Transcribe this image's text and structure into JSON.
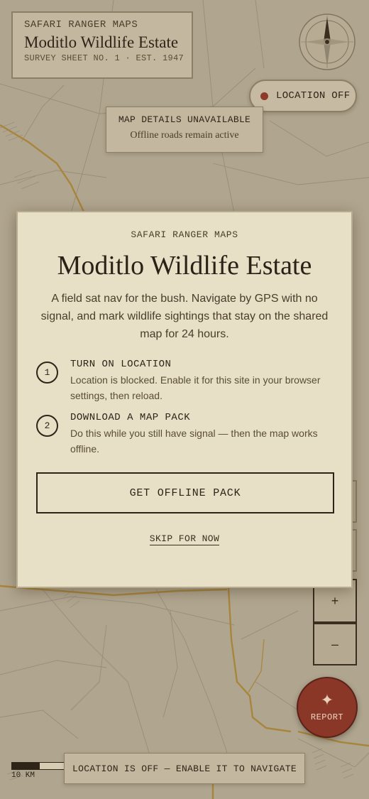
{
  "map": {
    "background": "#b0a58e",
    "road_color": "#a8853d",
    "line_color": "#8f8672"
  },
  "title_card": {
    "kicker": "SAFARI RANGER MAPS",
    "name": "Moditlo Wildlife Estate",
    "sheet": "SURVEY SHEET NO. 1 · EST. 1947"
  },
  "compass": {
    "icon": "compass-rose-icon"
  },
  "location_pill": {
    "label": "LOCATION OFF",
    "status_color": "#8d3a2a"
  },
  "details_card": {
    "heading": "MAP DETAILS UNAVAILABLE",
    "subtext": "Offline roads remain active"
  },
  "zoom": {
    "in_label": "+",
    "out_label": "–"
  },
  "report": {
    "label": "REPORT",
    "icon": "sparkle-icon",
    "color": "#8b3728"
  },
  "scale": {
    "label": "10 KM"
  },
  "status_bar": {
    "text": "LOCATION IS OFF — ENABLE IT TO NAVIGATE"
  },
  "modal": {
    "kicker": "SAFARI RANGER MAPS",
    "title": "Moditlo Wildlife Estate",
    "description": "A field sat nav for the bush. Navigate by GPS with no signal, and mark wildlife sightings that stay on the shared map for 24 hours.",
    "steps": [
      {
        "number": "1",
        "title": "TURN ON LOCATION",
        "description": "Location is blocked. Enable it for this site in your browser settings, then reload."
      },
      {
        "number": "2",
        "title": "DOWNLOAD A MAP PACK",
        "description": "Do this while you still have signal — then the map works offline."
      }
    ],
    "cta_label": "GET OFFLINE PACK",
    "skip_label": "SKIP FOR NOW"
  }
}
